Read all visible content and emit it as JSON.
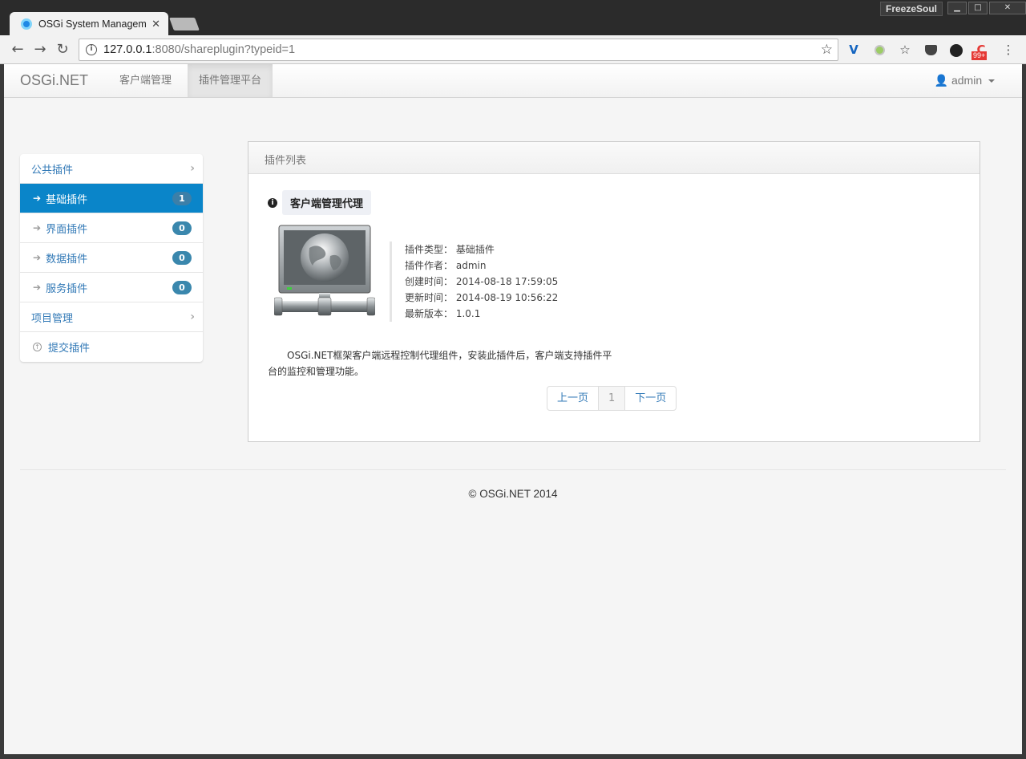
{
  "browser": {
    "tab_title": "OSGi System Managem",
    "profile_name": "FreezeSoul",
    "url_host": "127.0.0.1",
    "url_path": ":8080/shareplugin?typeid=1",
    "ext_badge": "99+"
  },
  "navbar": {
    "brand": "OSGi.NET",
    "links": [
      "客户端管理",
      "插件管理平台"
    ],
    "user": "admin"
  },
  "sidebar": {
    "items": [
      {
        "label": "公共插件"
      },
      {
        "label": "基础插件",
        "count": "1"
      },
      {
        "label": "界面插件",
        "count": "0"
      },
      {
        "label": "数据插件",
        "count": "0"
      },
      {
        "label": "服务插件",
        "count": "0"
      },
      {
        "label": "项目管理"
      },
      {
        "label": "提交插件"
      }
    ]
  },
  "panel": {
    "heading": "插件列表",
    "plugin": {
      "title": "客户端管理代理",
      "meta": [
        {
          "key": "插件类型：",
          "value": "基础插件"
        },
        {
          "key": "插件作者：",
          "value": "admin"
        },
        {
          "key": "创建时间：",
          "value": "2014-08-18 17:59:05"
        },
        {
          "key": "更新时间：",
          "value": "2014-08-19 10:56:22"
        },
        {
          "key": "最新版本：",
          "value": "1.0.1"
        }
      ],
      "description": "OSGi.NET框架客户端远程控制代理组件，安装此插件后，客户端支持插件平台的监控和管理功能。"
    },
    "pager": {
      "prev": "上一页",
      "current": "1",
      "next": "下一页"
    }
  },
  "footer": "© OSGi.NET 2014"
}
